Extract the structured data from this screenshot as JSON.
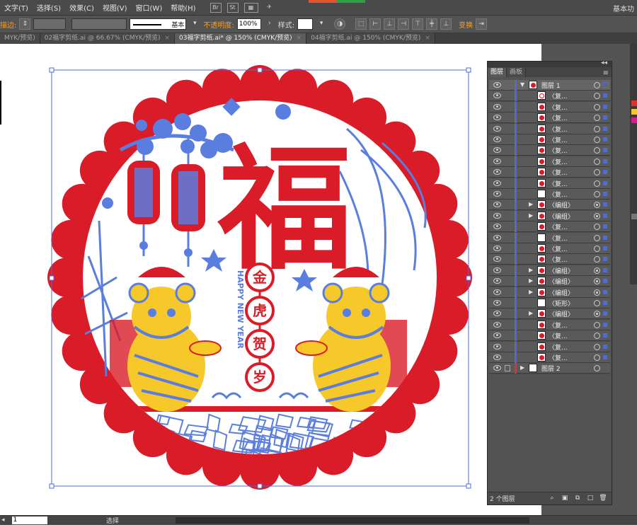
{
  "menubar": {
    "items": [
      "文字(T)",
      "选择(S)",
      "效果(C)",
      "视图(V)",
      "窗口(W)",
      "帮助(H)"
    ],
    "badges": [
      "Br",
      "St"
    ],
    "workspace": "基本功"
  },
  "controlbar": {
    "stroke_label": "描边:",
    "stroke_profile": "基本",
    "opacity_label": "不透明度:",
    "opacity_value": "100%",
    "style_label": "样式:",
    "transform_label": "变换"
  },
  "tabs": [
    {
      "label": "MYK/预览)",
      "active": false
    },
    {
      "label": "02福字剪纸.ai @ 66.67% (CMYK/预览)",
      "active": false
    },
    {
      "label": "03福字剪纸.ai* @ 150% (CMYK/预览)",
      "active": true
    },
    {
      "label": "04福字剪纸.ai @ 150% (CMYK/预览)",
      "active": false
    }
  ],
  "artwork": {
    "main_char": "福",
    "side_chars": [
      "金",
      "虎",
      "贺",
      "岁"
    ],
    "english": "HAPPY NEW YEAR",
    "colors": {
      "red": "#d91c28",
      "blue": "#5a7de0",
      "yellow": "#f7c82a",
      "selection": "#4f6bd8"
    }
  },
  "layers_panel": {
    "tabs": [
      "图层",
      "画板"
    ],
    "rows": [
      {
        "label": "图层 1",
        "level": 0,
        "expanded": true,
        "thumb": "full"
      },
      {
        "label": "〈复...",
        "level": 1,
        "thumb": "outline"
      },
      {
        "label": "〈复...",
        "level": 1,
        "thumb": "full"
      },
      {
        "label": "〈复...",
        "level": 1,
        "thumb": "full"
      },
      {
        "label": "〈复...",
        "level": 1,
        "thumb": "full"
      },
      {
        "label": "〈复...",
        "level": 1,
        "thumb": "full"
      },
      {
        "label": "〈复...",
        "level": 1,
        "thumb": "full"
      },
      {
        "label": "〈复...",
        "level": 1,
        "thumb": "full"
      },
      {
        "label": "〈复...",
        "level": 1,
        "thumb": "full"
      },
      {
        "label": "〈复...",
        "level": 1,
        "thumb": "full"
      },
      {
        "label": "〈复...",
        "level": 1,
        "thumb": "blank"
      },
      {
        "label": "〈编组〉",
        "level": 1,
        "group": true,
        "thumb": "full"
      },
      {
        "label": "〈编组〉",
        "level": 1,
        "group": true,
        "thumb": "full"
      },
      {
        "label": "〈复...",
        "level": 1,
        "thumb": "full"
      },
      {
        "label": "〈复...",
        "level": 1,
        "thumb": "blank"
      },
      {
        "label": "〈复...",
        "level": 1,
        "thumb": "full"
      },
      {
        "label": "〈复...",
        "level": 1,
        "thumb": "full"
      },
      {
        "label": "〈编组〉",
        "level": 1,
        "group": true,
        "thumb": "full"
      },
      {
        "label": "〈编组〉",
        "level": 1,
        "group": true,
        "thumb": "full"
      },
      {
        "label": "〈编组〉",
        "level": 1,
        "group": true,
        "thumb": "full"
      },
      {
        "label": "〈矩形〉",
        "level": 1,
        "thumb": "blank"
      },
      {
        "label": "〈编组〉",
        "level": 1,
        "group": true,
        "thumb": "full"
      },
      {
        "label": "〈复...",
        "level": 1,
        "thumb": "full"
      },
      {
        "label": "〈复...",
        "level": 1,
        "thumb": "full"
      },
      {
        "label": "〈复...",
        "level": 1,
        "thumb": "full"
      },
      {
        "label": "〈复...",
        "level": 1,
        "thumb": "full"
      },
      {
        "label": "图层 2",
        "level": 0,
        "expanded": false,
        "locked": true,
        "thumb": "blank"
      }
    ],
    "footer_count": "2 个图层"
  },
  "statusbar": {
    "zoom": "1",
    "tool": "选择"
  }
}
